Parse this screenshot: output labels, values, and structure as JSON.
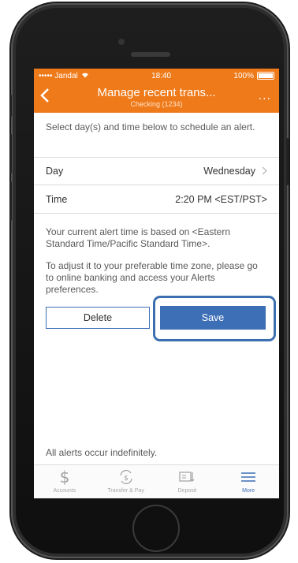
{
  "status_bar": {
    "carrier": "••••• Jandal",
    "time": "18:40",
    "battery": "100%"
  },
  "nav": {
    "title": "Manage recent trans...",
    "subtitle": "Checking (1234)",
    "back_icon": "chevron-left-icon",
    "more_label": "..."
  },
  "intro_text": "Select day(s) and time below to schedule an alert.",
  "rows": {
    "day": {
      "label": "Day",
      "value": "Wednesday"
    },
    "time": {
      "label": "Time",
      "value": "2:20 PM <EST/PST>"
    }
  },
  "info": {
    "line1": "Your current alert time is based on <Eastern Standard Time/Pacific Standard Time>.",
    "line2": "To adjust it to your preferable time zone, please go to online banking and access your Alerts preferences."
  },
  "buttons": {
    "delete": "Delete",
    "save": "Save"
  },
  "footer_note": "All alerts occur indefinitely.",
  "tabs": [
    {
      "label": "Accounts",
      "icon": "dollar-icon",
      "active": false
    },
    {
      "label": "Transfer & Pay",
      "icon": "transfer-icon",
      "active": false
    },
    {
      "label": "Deposit",
      "icon": "deposit-icon",
      "active": false
    },
    {
      "label": "More",
      "icon": "menu-icon",
      "active": true
    }
  ],
  "colors": {
    "brand": "#ef7a1a",
    "accent": "#3d6fb6"
  }
}
